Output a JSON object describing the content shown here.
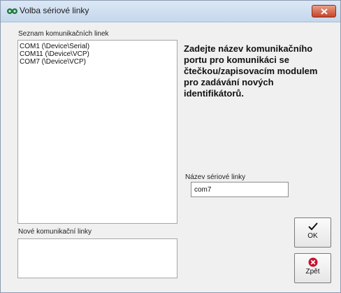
{
  "window": {
    "title": "Volba sériové linky"
  },
  "lines_list": {
    "label": "Seznam komunikačních linek",
    "items": [
      {
        "label": "COM1 (\\Device\\Serial)"
      },
      {
        "label": "COM11 (\\Device\\VCP)"
      },
      {
        "label": "COM7 (\\Device\\VCP)"
      }
    ]
  },
  "new_lines": {
    "label": "Nové komunikační linky"
  },
  "instructions": "Zadejte název komunikačního\nportu pro komunikáci se\nčtečkou/zapisovacím modulem\npro zadávání nových\nidentifikátorů.",
  "serial_name": {
    "label": "Název sériové linky",
    "value": "com7"
  },
  "buttons": {
    "ok_label": "OK",
    "back_label": "Zpět"
  },
  "colors": {
    "close_button": "#c7432a",
    "back_icon": "#c8102e",
    "app_icon": "#1f7a3a"
  }
}
